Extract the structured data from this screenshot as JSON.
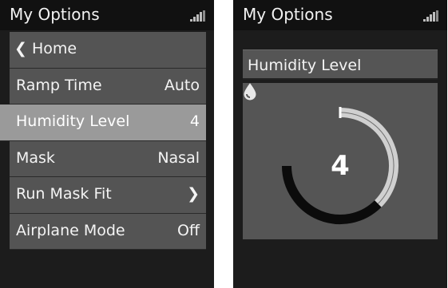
{
  "left_screen": {
    "title": "My Options",
    "menu": [
      {
        "label": "Home",
        "value": "",
        "selected": false
      },
      {
        "label": "Ramp Time",
        "value": "Auto",
        "selected": false
      },
      {
        "label": "Humidity Level",
        "value": "4",
        "selected": true
      },
      {
        "label": "Mask",
        "value": "Nasal",
        "selected": false
      },
      {
        "label": "Run Mask Fit",
        "value": "",
        "selected": false
      },
      {
        "label": "Airplane Mode",
        "value": "Off",
        "selected": false
      }
    ]
  },
  "right_screen": {
    "title": "My Options",
    "panel_title": "Humidity Level",
    "level_value": "4",
    "level_fraction": 0.5
  },
  "icons": {
    "signal": "signal-strength-icon",
    "back": "chevron-left-icon",
    "forward": "chevron-right-icon",
    "humidity": "water-drop-icon"
  },
  "colors": {
    "screen_bg": "#1c1c1c",
    "menu_item_bg": "#545454",
    "selected_bg": "#9a9a9a",
    "arc_active": "#d0d0d0",
    "arc_track": "#0b0b0b"
  }
}
